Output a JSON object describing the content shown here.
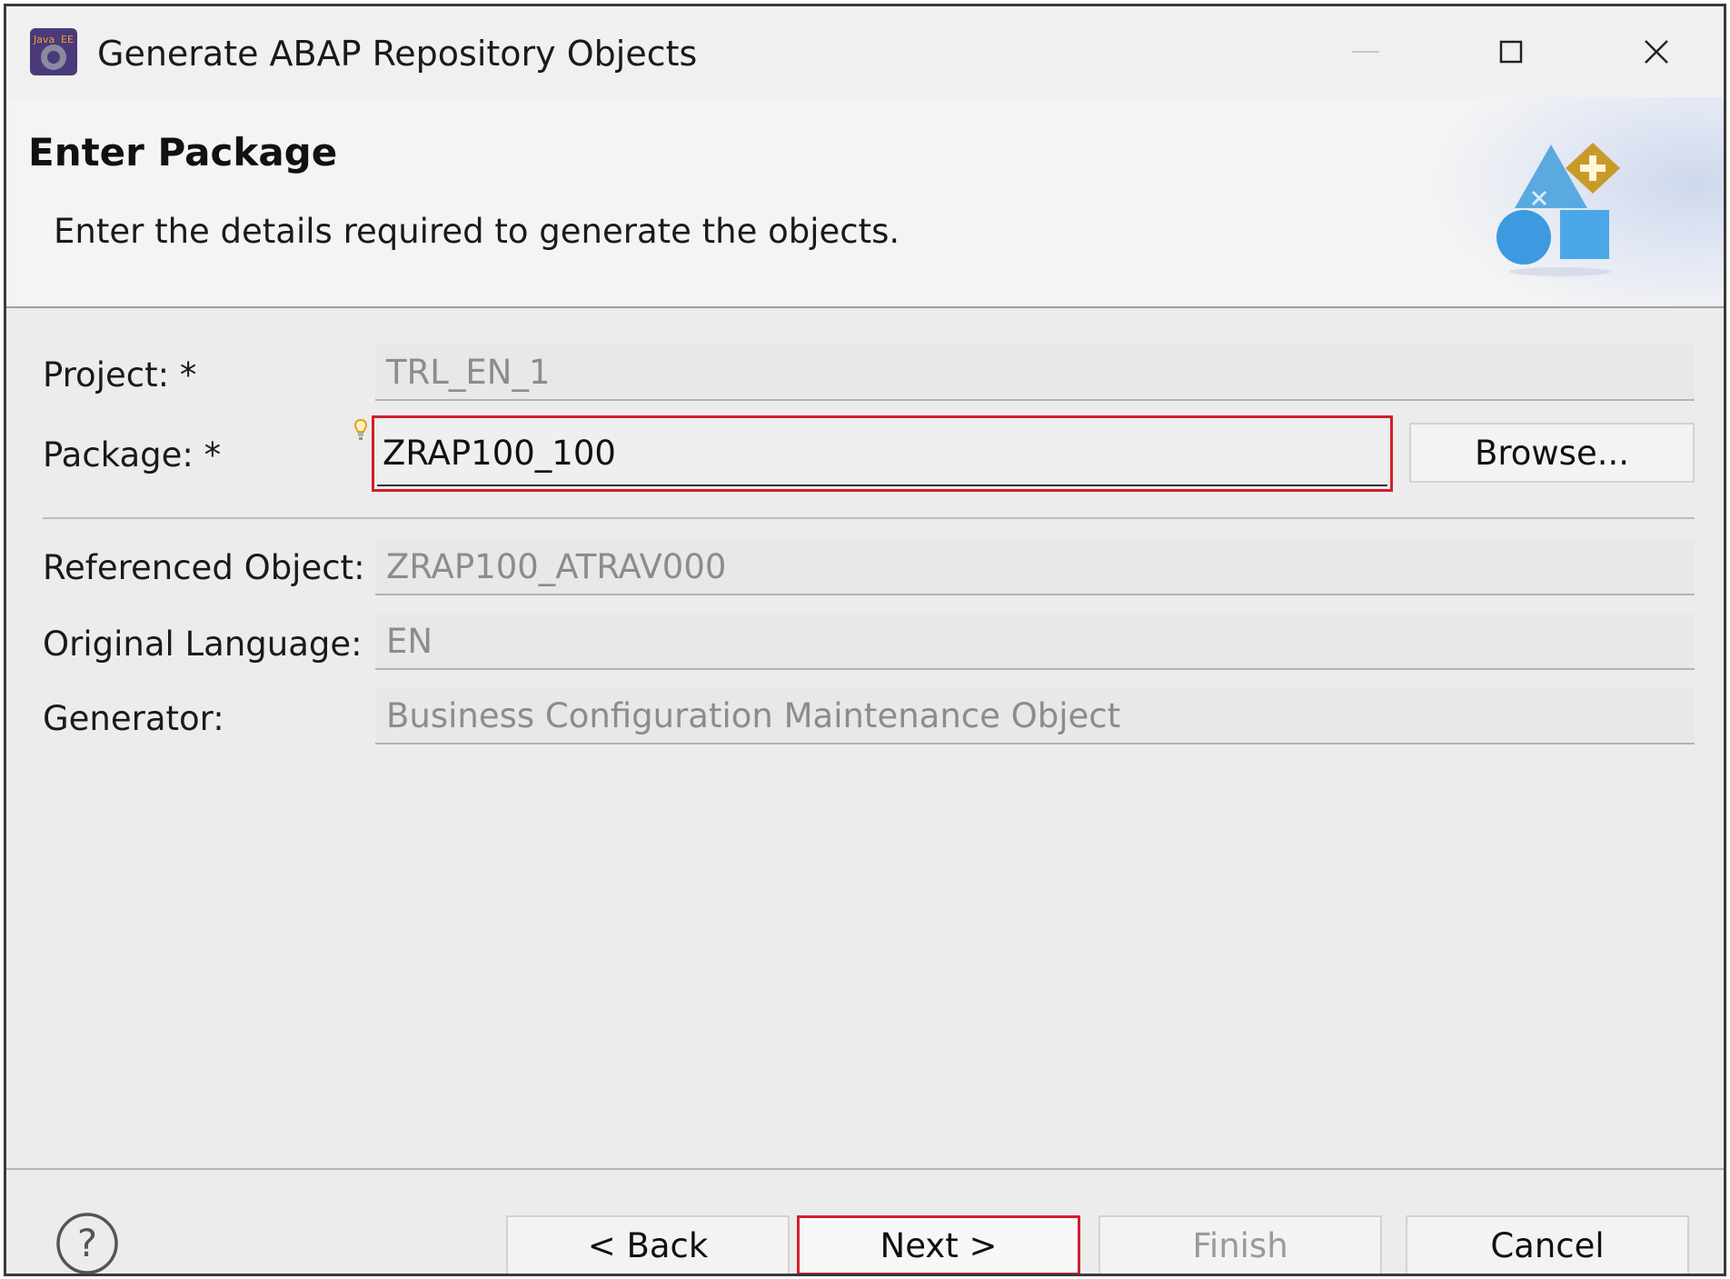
{
  "window": {
    "title": "Generate ABAP Repository Objects",
    "app_icon_text": "Java EE IDE",
    "minimize_icon": "minimize-icon",
    "maximize_icon": "maximize-icon",
    "close_icon": "close-icon"
  },
  "header": {
    "title": "Enter Package",
    "description": "Enter the details required to generate the objects.",
    "icon": "shapes-wizard-icon"
  },
  "form": {
    "project": {
      "label": "Project: *",
      "value": "TRL_EN_1"
    },
    "package": {
      "label": "Package: *",
      "value": "ZRAP100_100",
      "hint_icon": "lightbulb-hint-icon"
    },
    "browse_label": "Browse...",
    "referenced_object": {
      "label": "Referenced Object:",
      "value": "ZRAP100_ATRAV000"
    },
    "original_language": {
      "label": "Original Language:",
      "value": "EN"
    },
    "generator": {
      "label": "Generator:",
      "value": "Business Configuration Maintenance Object"
    }
  },
  "footer": {
    "help_icon": "help-icon",
    "back_label": "< Back",
    "next_label": "Next >",
    "finish_label": "Finish",
    "cancel_label": "Cancel"
  },
  "colors": {
    "highlight": "#d21f2b",
    "disabled_text": "#8c8c8c",
    "icon_blue": "#4aa3df",
    "icon_gold": "#c89a2a"
  }
}
